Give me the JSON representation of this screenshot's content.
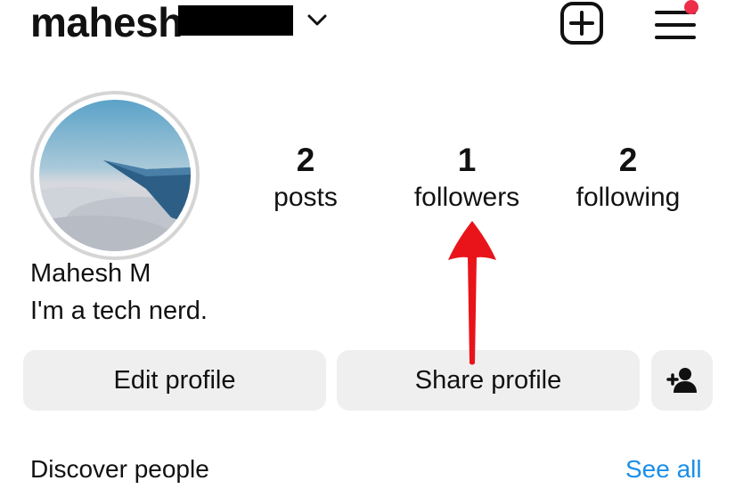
{
  "header": {
    "username": "mahesh",
    "username_redacted": true,
    "icons": [
      "chevron-down-icon",
      "create-post-icon",
      "menu-icon"
    ],
    "notification_dot_color": "#ed2e4b"
  },
  "profile": {
    "avatar_description": "airplane wing over clouds",
    "full_name": "Mahesh M",
    "bio": "I'm a tech nerd."
  },
  "stats": [
    {
      "value": "2",
      "label": "posts"
    },
    {
      "value": "1",
      "label": "followers"
    },
    {
      "value": "2",
      "label": "following"
    }
  ],
  "buttons": {
    "edit_profile": "Edit profile",
    "share_profile": "Share profile",
    "add_friend_icon": "add-person-icon"
  },
  "discover": {
    "title": "Discover people",
    "see_all": "See all",
    "link_color": "#1a8fe8"
  },
  "annotation": {
    "type": "arrow",
    "color": "#e8141a",
    "points_to": "followers"
  }
}
